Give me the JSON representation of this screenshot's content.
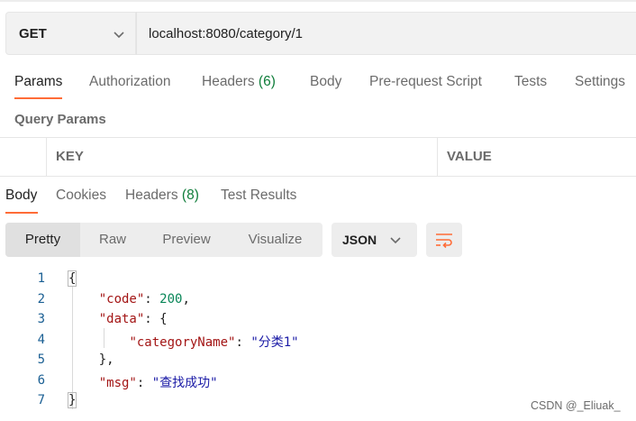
{
  "request": {
    "method": "GET",
    "url": "localhost:8080/category/1"
  },
  "request_tabs": [
    {
      "label": "Params",
      "count": ""
    },
    {
      "label": "Authorization",
      "count": ""
    },
    {
      "label": "Headers",
      "count": "(6)"
    },
    {
      "label": "Body",
      "count": ""
    },
    {
      "label": "Pre-request Script",
      "count": ""
    },
    {
      "label": "Tests",
      "count": ""
    },
    {
      "label": "Settings",
      "count": ""
    }
  ],
  "query_params": {
    "title": "Query Params",
    "columns": [
      "KEY",
      "VALUE"
    ]
  },
  "response_tabs": [
    {
      "label": "Body",
      "count": ""
    },
    {
      "label": "Cookies",
      "count": ""
    },
    {
      "label": "Headers",
      "count": "(8)"
    },
    {
      "label": "Test Results",
      "count": ""
    }
  ],
  "view_modes": [
    "Pretty",
    "Raw",
    "Preview",
    "Visualize"
  ],
  "format": "JSON",
  "response_lines": [
    {
      "no": "1",
      "tokens": [
        {
          "t": "punc",
          "v": "{"
        }
      ]
    },
    {
      "no": "2",
      "tokens": [
        {
          "t": "punc",
          "v": "    "
        },
        {
          "t": "key",
          "v": "\"code\""
        },
        {
          "t": "punc",
          "v": ": "
        },
        {
          "t": "num",
          "v": "200"
        },
        {
          "t": "punc",
          "v": ","
        }
      ]
    },
    {
      "no": "3",
      "tokens": [
        {
          "t": "punc",
          "v": "    "
        },
        {
          "t": "key",
          "v": "\"data\""
        },
        {
          "t": "punc",
          "v": ": {"
        }
      ]
    },
    {
      "no": "4",
      "tokens": [
        {
          "t": "punc",
          "v": "        "
        },
        {
          "t": "key",
          "v": "\"categoryName\""
        },
        {
          "t": "punc",
          "v": ": "
        },
        {
          "t": "str",
          "v": "\"分类1\""
        }
      ]
    },
    {
      "no": "5",
      "tokens": [
        {
          "t": "punc",
          "v": "    },"
        }
      ]
    },
    {
      "no": "6",
      "tokens": [
        {
          "t": "punc",
          "v": "    "
        },
        {
          "t": "key",
          "v": "\"msg\""
        },
        {
          "t": "punc",
          "v": ": "
        },
        {
          "t": "str",
          "v": "\"查找成功\""
        }
      ]
    },
    {
      "no": "7",
      "tokens": [
        {
          "t": "punc",
          "v": "}"
        }
      ]
    }
  ],
  "watermark": "CSDN @_Eliuak_",
  "colors": {
    "accent": "#ff6c37",
    "count": "#0f7d3a",
    "json_key": "#a31515",
    "json_string": "#1a1aa6",
    "json_number": "#098658"
  }
}
